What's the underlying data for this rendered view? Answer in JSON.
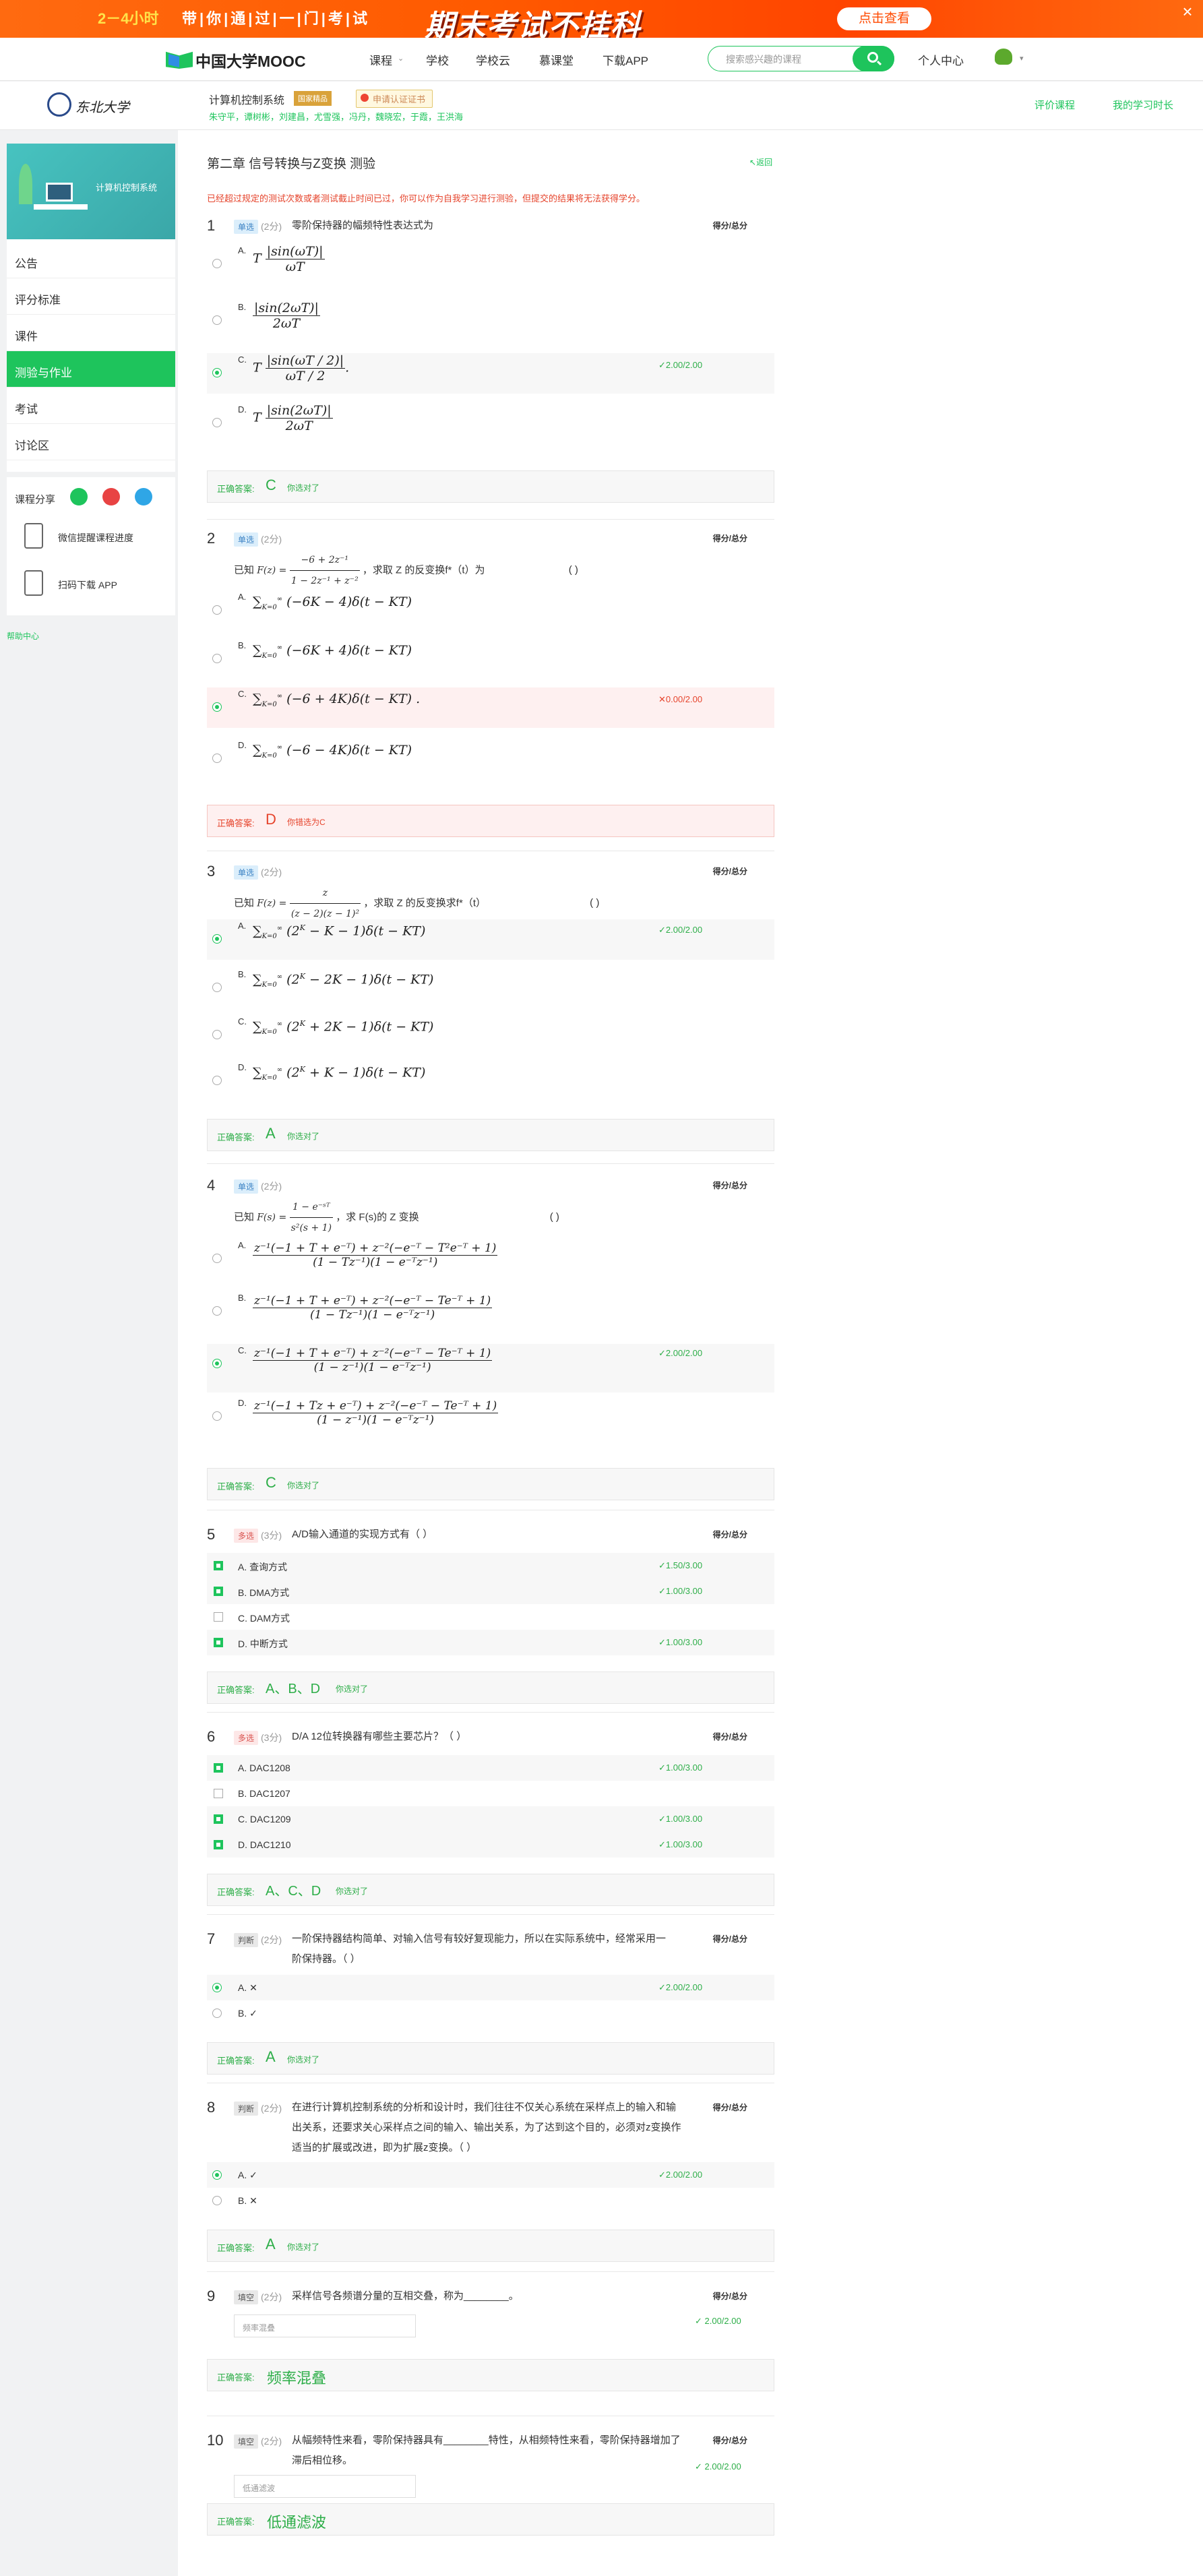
{
  "ad": {
    "lead": "2－4小时",
    "slogan": "带|你|通|过|一|门|考|试",
    "headline": "期末考试不挂科",
    "button": "点击查看",
    "close": "×"
  },
  "nav": {
    "logo": "中国大学MOOC",
    "items": [
      "课程",
      "学校",
      "学校云",
      "慕课堂",
      "下载APP"
    ],
    "search_placeholder": "搜索感兴趣的课程",
    "user": "个人中心"
  },
  "course": {
    "university": "东北大学",
    "title": "计算机控制系统",
    "level_tag": "国家精品",
    "cert_tag": "申请认证证书",
    "teachers": "朱守平，谭树彬，刘建昌，尤雪强，冯丹，魏晓宏，于霞，王洪海",
    "links": [
      "评价课程",
      "我的学习时长"
    ]
  },
  "sidebar": {
    "cover_title": "计算机控制系统",
    "items": [
      "公告",
      "评分标准",
      "课件",
      "测验与作业",
      "考试",
      "讨论区"
    ],
    "active": "测验与作业",
    "share_label": "课程分享",
    "app1": "微信提醒课程进度",
    "app2": "扫码下载 APP",
    "help": "帮助中心"
  },
  "page": {
    "title": "第二章 信号转换与Z变换 测验",
    "back": "返回",
    "notice": "已经超过规定的测试次数或者测试截止时间已过，你可以作为自我学习进行测验，但提交的结果将无法获得学分。"
  },
  "labels": {
    "correct": "正确答案:",
    "you_right": "你选对了",
    "you_wrong": "你错选为C",
    "you_right_fill": "",
    "score": "得分/总分"
  },
  "q1": {
    "num": "1",
    "type": "单选",
    "pts": "(2分)",
    "text": "零阶保持器的幅频特性表达式为",
    "result": "✓2.00/2.00",
    "answer": "C"
  },
  "q2": {
    "num": "2",
    "type": "单选",
    "pts": "(2分)",
    "text_a": "已知",
    "text_b": "，求取 Z 的反变换f*（t）为",
    "blank": "(        )",
    "result": "✕0.00/2.00",
    "answer": "D"
  },
  "q3": {
    "num": "3",
    "type": "单选",
    "pts": "(2分)",
    "text_a": "已知",
    "text_b": "，求取 Z 的反变换求f*（t）",
    "blank": "(        )",
    "result": "✓2.00/2.00",
    "answer": "A"
  },
  "q4": {
    "num": "4",
    "type": "单选",
    "pts": "(2分)",
    "text_a": "已知",
    "text_b": "，求 F(s)的 Z 变换",
    "blank": "(        )",
    "result": "✓2.00/2.00",
    "answer": "C"
  },
  "q5": {
    "num": "5",
    "type": "多选",
    "pts": "(3分)",
    "text": "A/D输入通道的实现方式有（     ）",
    "opts": [
      "A. 查询方式",
      "B. DMA方式",
      "C. DAM方式",
      "D. 中断方式"
    ],
    "results": [
      "✓1.50/3.00",
      "✓1.00/3.00",
      "",
      "✓1.00/3.00"
    ],
    "answer": "A、B、D"
  },
  "q6": {
    "num": "6",
    "type": "多选",
    "pts": "(3分)",
    "text": "D/A 12位转换器有哪些主要芯片？（                    ）",
    "opts": [
      "A. DAC1208",
      "B. DAC1207",
      "C. DAC1209",
      "D. DAC1210"
    ],
    "results": [
      "✓1.00/3.00",
      "",
      "✓1.00/3.00",
      "✓1.00/3.00"
    ],
    "answer": "A、C、D"
  },
  "q7": {
    "num": "7",
    "type": "判断",
    "pts": "(2分)",
    "text": "一阶保持器结构简单、对输入信号有较好复现能力，所以在实际系统中，经常采用一阶保持器。（     ）",
    "opts": [
      "A. ✕",
      "B. ✓"
    ],
    "result": "✓2.00/2.00",
    "answer": "A"
  },
  "q8": {
    "num": "8",
    "type": "判断",
    "pts": "(2分)",
    "text": "在进行计算机控制系统的分析和设计时，我们往往不仅关心系统在采样点上的输入和输出关系，还要求关心采样点之间的输入、输出关系，为了达到这个目的，必须对z变换作适当的扩展或改进，即为扩展z变换。（     ）",
    "opts": [
      "A. ✓",
      "B. ✕"
    ],
    "result": "✓2.00/2.00",
    "answer": "A"
  },
  "q9": {
    "num": "9",
    "type": "填空",
    "pts": "(2分)",
    "text": "采样信号各频谱分量的互相交叠，称为________。",
    "input": "频率混叠",
    "result": "✓ 2.00/2.00",
    "answer": "频率混叠"
  },
  "q10": {
    "num": "10",
    "type": "填空",
    "pts": "(2分)",
    "text": "从幅频特性来看，零阶保持器具有________特性，从相频特性来看，零阶保持器增加了滞后相位移。",
    "input": "低通滤波",
    "result": "✓ 2.00/2.00",
    "answer": "低通滤波"
  }
}
